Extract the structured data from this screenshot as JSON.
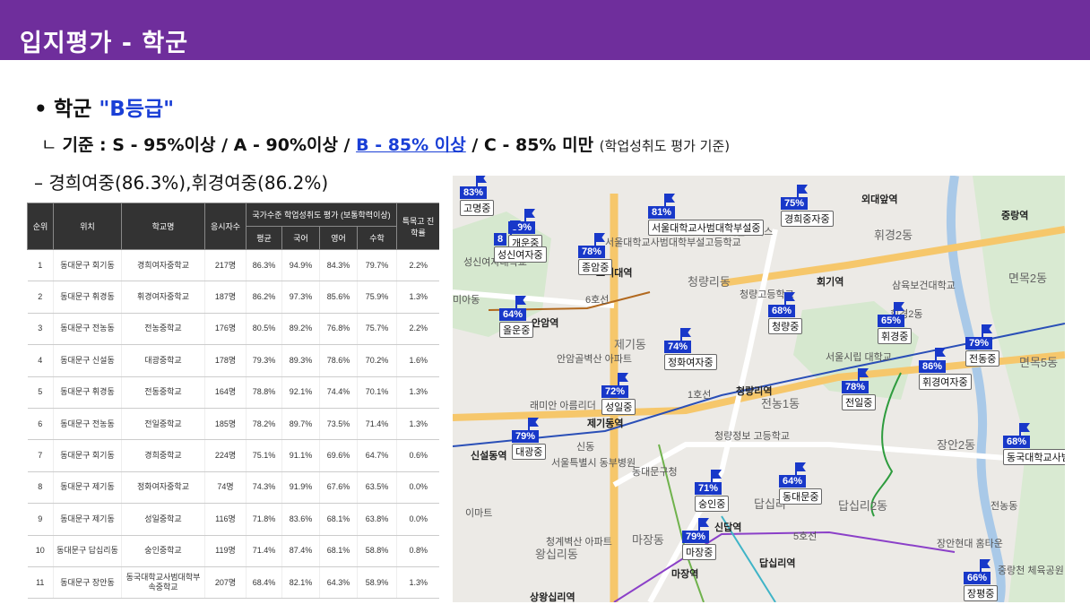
{
  "header": {
    "title": "입지평가 - 학군"
  },
  "bullet": {
    "dot": "•",
    "prefix": "학군 ",
    "grade": "\"B등급\""
  },
  "criteria": {
    "corner": "ㄴ",
    "prefix": "기준 : S - 95%이상 / A - 90%이상 / ",
    "b_grade": "B - 85% 이상",
    "suffix": " / C - 85% 미만 ",
    "note": "(학업성취도 평가 기준)"
  },
  "schools_line": "–  경희여중(86.3%),휘경여중(86.2%)",
  "table": {
    "headers": {
      "rank": "순위",
      "location": "위치",
      "school": "학교명",
      "students": "응시자수",
      "group": "국가수준 학업성취도 평가 (보통학력이상)",
      "avg": "평균",
      "kor": "국어",
      "eng": "영어",
      "math": "수학",
      "special": "특목고 진학률"
    },
    "rows": [
      {
        "rank": "1",
        "location": "동대문구 회기동",
        "school": "경희여자중학교",
        "students": "217명",
        "avg": "86.3%",
        "kor": "94.9%",
        "eng": "84.3%",
        "math": "79.7%",
        "special": "2.2%"
      },
      {
        "rank": "2",
        "location": "동대문구 휘경동",
        "school": "휘경여자중학교",
        "students": "187명",
        "avg": "86.2%",
        "kor": "97.3%",
        "eng": "85.6%",
        "math": "75.9%",
        "special": "1.3%"
      },
      {
        "rank": "3",
        "location": "동대문구 전농동",
        "school": "전농중학교",
        "students": "176명",
        "avg": "80.5%",
        "kor": "89.2%",
        "eng": "76.8%",
        "math": "75.7%",
        "special": "2.2%"
      },
      {
        "rank": "4",
        "location": "동대문구 신설동",
        "school": "대광중학교",
        "students": "178명",
        "avg": "79.3%",
        "kor": "89.3%",
        "eng": "78.6%",
        "math": "70.2%",
        "special": "1.6%"
      },
      {
        "rank": "5",
        "location": "동대문구 휘경동",
        "school": "전동중학교",
        "students": "164명",
        "avg": "78.8%",
        "kor": "92.1%",
        "eng": "74.4%",
        "math": "70.1%",
        "special": "1.3%"
      },
      {
        "rank": "6",
        "location": "동대문구 전농동",
        "school": "전일중학교",
        "students": "185명",
        "avg": "78.2%",
        "kor": "89.7%",
        "eng": "73.5%",
        "math": "71.4%",
        "special": "1.3%"
      },
      {
        "rank": "7",
        "location": "동대문구 회기동",
        "school": "경희중학교",
        "students": "224명",
        "avg": "75.1%",
        "kor": "91.1%",
        "eng": "69.6%",
        "math": "64.7%",
        "special": "0.6%"
      },
      {
        "rank": "8",
        "location": "동대문구 제기동",
        "school": "정화여자중학교",
        "students": "74명",
        "avg": "74.3%",
        "kor": "91.9%",
        "eng": "67.6%",
        "math": "63.5%",
        "special": "0.0%"
      },
      {
        "rank": "9",
        "location": "동대문구 제기동",
        "school": "성일중학교",
        "students": "116명",
        "avg": "71.8%",
        "kor": "83.6%",
        "eng": "68.1%",
        "math": "63.8%",
        "special": "0.0%"
      },
      {
        "rank": "10",
        "location": "동대문구 답십리동",
        "school": "숭인중학교",
        "students": "119명",
        "avg": "71.4%",
        "kor": "87.4%",
        "eng": "68.1%",
        "math": "58.8%",
        "special": "0.8%"
      },
      {
        "rank": "11",
        "location": "동대문구 장안동",
        "school": "동국대학교사범대학부속중학교",
        "students": "207명",
        "avg": "68.4%",
        "kor": "82.1%",
        "eng": "64.3%",
        "math": "58.9%",
        "special": "1.3%"
      }
    ]
  },
  "map": {
    "markers": [
      {
        "pct": "83%",
        "name": "고명중"
      },
      {
        "pct": "89%",
        "name": "개운중"
      },
      {
        "pct": "8",
        "name": "성신여자중"
      },
      {
        "pct": "78%",
        "name": "종암중"
      },
      {
        "pct": "81%",
        "name": "서울대학교사범대학부설중"
      },
      {
        "pct": "75%",
        "name": "경희중자중"
      },
      {
        "pct": "64%",
        "name": "올운중"
      },
      {
        "pct": "68%",
        "name": "청량중"
      },
      {
        "pct": "65%",
        "name": "휘경중"
      },
      {
        "pct": "79%",
        "name": "전동중"
      },
      {
        "pct": "74%",
        "name": "정화여자중"
      },
      {
        "pct": "86%",
        "name": "휘경여자중"
      },
      {
        "pct": "72%",
        "name": "성일중"
      },
      {
        "pct": "78%",
        "name": "전일중"
      },
      {
        "pct": "79%",
        "name": "대광중"
      },
      {
        "pct": "68%",
        "name": "동국대학교사범"
      },
      {
        "pct": "71%",
        "name": "숭인중"
      },
      {
        "pct": "64%",
        "name": "동대문중"
      },
      {
        "pct": "79%",
        "name": "마장중"
      },
      {
        "pct": "66%",
        "name": "장평중"
      }
    ],
    "labels": {
      "l1": "미아동",
      "l2": "성신여자대학교",
      "l3": "고려대역",
      "l4": "서울대학교사범대학부설고등학교",
      "l5": "KAIST 서울캠퍼스",
      "l6": "외대앞역",
      "l7": "중랑역",
      "l8": "청량리동",
      "l9": "회기역",
      "l10": "면목2동",
      "l11": "안암역",
      "l12": "제기동",
      "l13": "청량리역",
      "l14": "전농1동",
      "l15": "휘경2동",
      "l16": "면목5동",
      "l17": "제기동역",
      "l18": "신설동역",
      "l19": "신동",
      "l20": "서울특별시 동부병원",
      "l21": "동대문구청",
      "l22": "답십리",
      "l23": "이마트",
      "l24": "신답역",
      "l25": "마장동",
      "l26": "왕십리동",
      "l27": "답십리역",
      "l28": "장안2동",
      "l29": "마장역",
      "l30": "상왕십리역",
      "l31": "장안현대 홈타운",
      "l32": "중랑천 체육공원",
      "l33": "삼육보건대학교",
      "l34": "청량고등학교",
      "l35": "휘경2동",
      "l36": "전농동",
      "l37": "답십리2동",
      "l38": "안암골벽산 아파트",
      "l39": "래미안 아름리더",
      "l40": "청계벽산 아파트",
      "l41": "청량정보 고등학교",
      "l42": "서울시립 대학교",
      "l43": "5호선",
      "l44": "6호선",
      "l45": "1호선"
    }
  }
}
